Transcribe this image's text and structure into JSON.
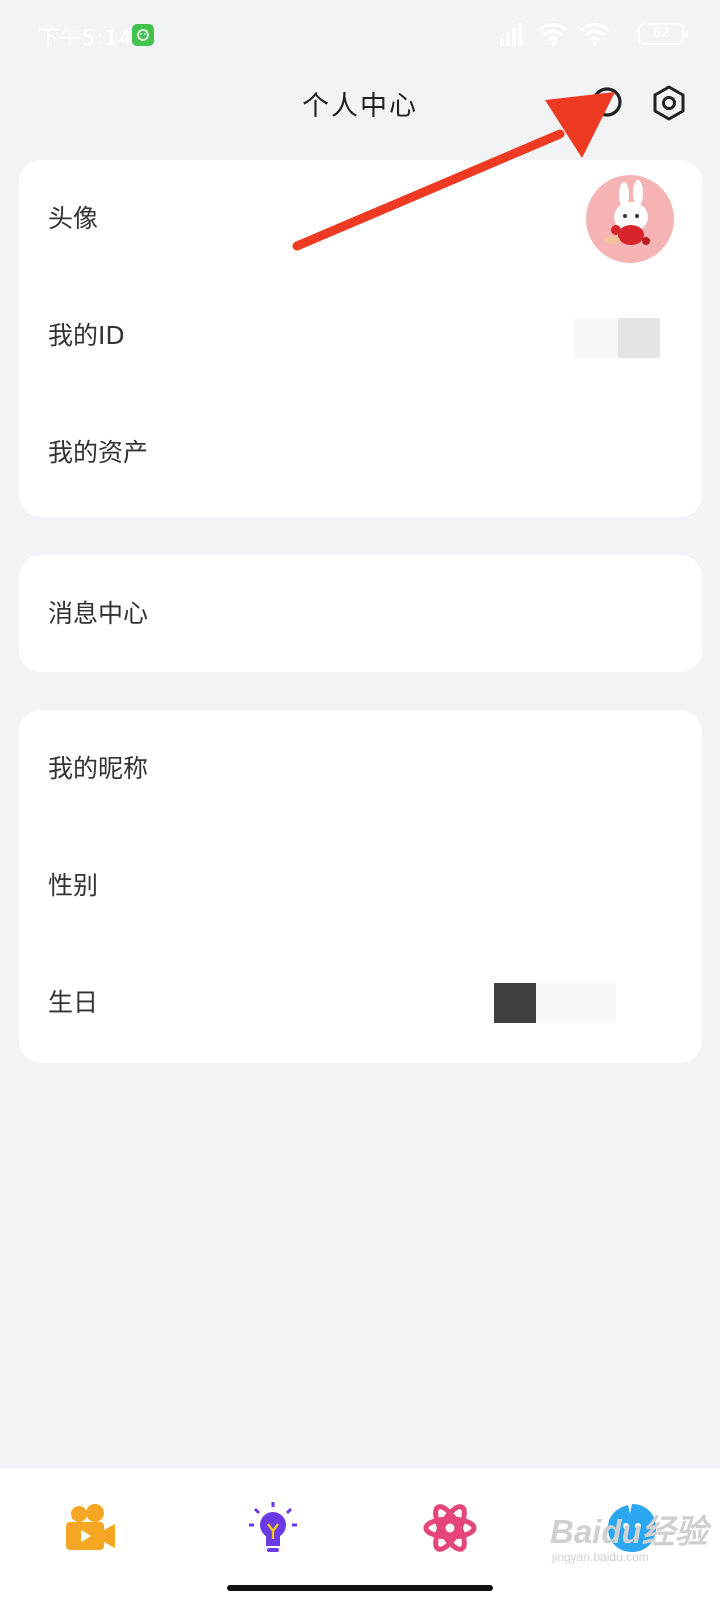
{
  "status_bar": {
    "time": "下午5:14",
    "battery": "82"
  },
  "header": {
    "title": "个人中心"
  },
  "profile_card": {
    "rows": [
      {
        "label": "头像"
      },
      {
        "label": "我的ID"
      },
      {
        "label": "我的资产"
      }
    ]
  },
  "message_card": {
    "rows": [
      {
        "label": "消息中心"
      }
    ]
  },
  "info_card": {
    "rows": [
      {
        "label": "我的昵称"
      },
      {
        "label": "性别"
      },
      {
        "label": "生日"
      }
    ]
  },
  "tab_bar": {
    "items": [
      {
        "icon": "video-camera-icon",
        "color": "#f5a623"
      },
      {
        "icon": "lightbulb-icon",
        "color": "#6a3be4"
      },
      {
        "icon": "atom-icon",
        "color": "#e6457a"
      },
      {
        "icon": "profile-drop-icon",
        "color": "#2aa7f0"
      }
    ]
  },
  "watermark": {
    "brand": "Baidu经验",
    "url": "jingyan.baidu.com"
  },
  "colors": {
    "background": "#f2f3f5",
    "card": "#ffffff",
    "annotation_arrow": "#ee3a22"
  }
}
